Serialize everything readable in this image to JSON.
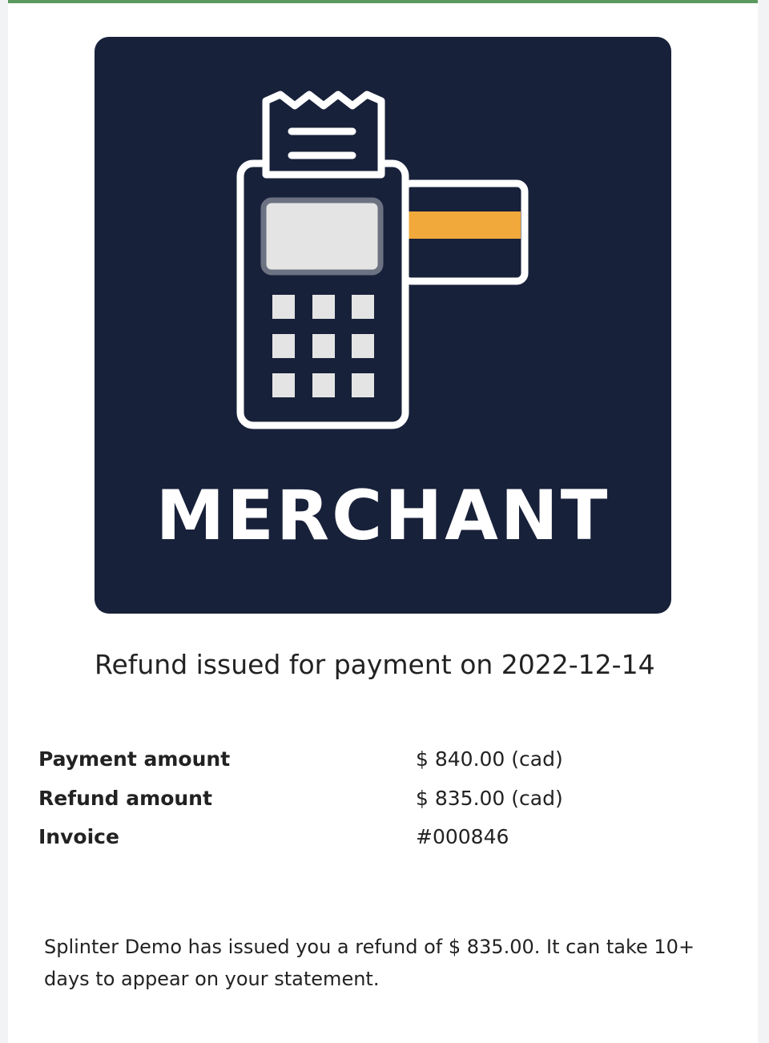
{
  "logo": {
    "icon": "payment-terminal-icon",
    "wordmark": "MERCHANT",
    "colors": {
      "background": "#18213a",
      "stroke": "#ffffff",
      "keys": "#e4e4e4",
      "card_stripe": "#f0a93a"
    }
  },
  "headline": "Refund issued for payment on 2022-12-14",
  "details": [
    {
      "label": "Payment amount",
      "value": "$ 840.00 (cad)"
    },
    {
      "label": "Refund amount",
      "value": "$ 835.00 (cad)"
    },
    {
      "label": "Invoice",
      "value": "#000846"
    }
  ],
  "message": "Splinter Demo has issued you a refund of $ 835.00. It can take 10+ days to appear on your statement.",
  "colors": {
    "accent_border": "#5a9a5e"
  }
}
